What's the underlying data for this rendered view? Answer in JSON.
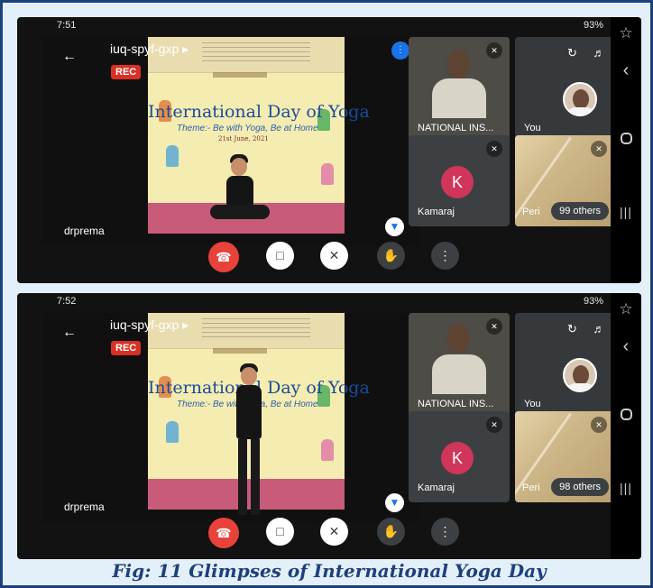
{
  "caption": "Fig: 11    Glimpses of International Yoga Day",
  "screens": [
    {
      "status_time": "7:51",
      "status_right": "93%",
      "meeting_id": "iuq-spyf-gxp ▸",
      "rec_label": "REC",
      "banner_title": "International Day of Yoga",
      "banner_theme": "Theme:- Be with Yoga, Be at Home",
      "banner_date": "21st June, 2021",
      "main_name": "drprema",
      "tiles": {
        "national": "NATIONAL INS...",
        "you": "You",
        "kamaraj": "Kamaraj",
        "kamaraj_initial": "K",
        "others_name": "Peri",
        "others_count": "99 others"
      }
    },
    {
      "status_time": "7:52",
      "status_right": "93%",
      "meeting_id": "iuq-spyf-gxp ▸",
      "rec_label": "REC",
      "banner_title": "International Day of Yoga",
      "banner_theme": "Theme:- Be with Yoga, Be at Home",
      "banner_date": "",
      "main_name": "drprema",
      "tiles": {
        "national": "NATIONAL INS...",
        "you": "You",
        "kamaraj": "Kamaraj",
        "kamaraj_initial": "K",
        "others_name": "Peri",
        "others_count": "98 others"
      }
    }
  ],
  "icons": {
    "back": "back-arrow-icon",
    "end_call": "phone-hangup-icon",
    "camera_off": "camera-off-icon",
    "mic_off": "mic-off-icon",
    "raise_hand": "hand-icon",
    "more": "more-vert-icon",
    "pin": "pin-icon"
  },
  "colors": {
    "end_call": "#e8423a",
    "rec": "#d93025",
    "accent": "#1a73e8",
    "avatar_k": "#d0355a",
    "caption": "#1f3f7c"
  }
}
